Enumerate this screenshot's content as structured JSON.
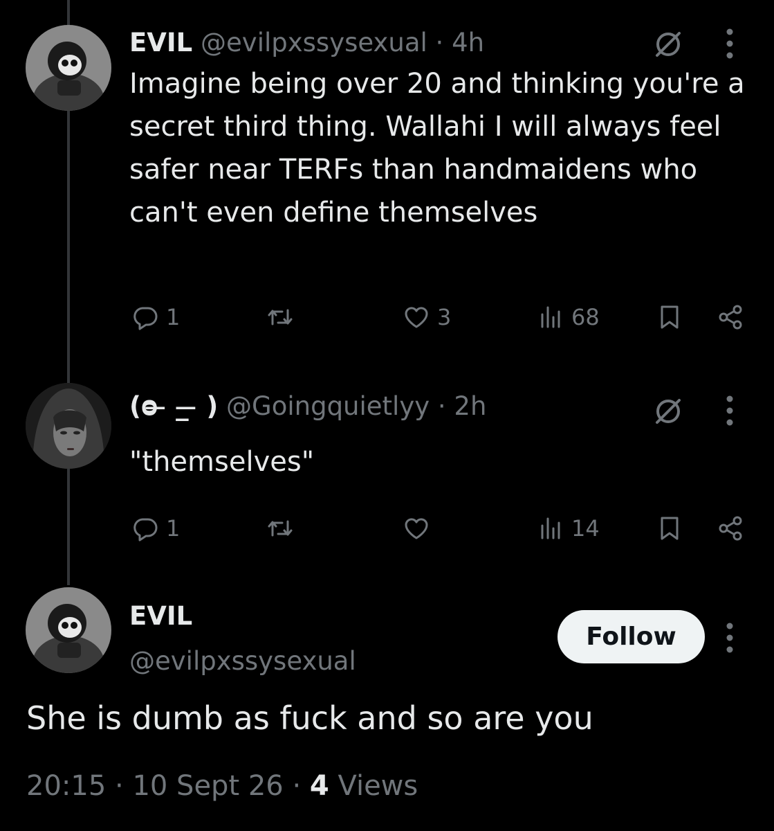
{
  "tweet1": {
    "display_name": "EVIL",
    "handle": "@evilpxssysexual",
    "time": "· 4h",
    "text": "Imagine being over 20 and thinking you're a secret third thing. Wallahi I will always feel safer near TERFs than handmaidens who can't even define themselves",
    "reply_count": "1",
    "like_count": "3",
    "view_count": "68"
  },
  "tweet2": {
    "display_name": "(ᴑ ̶ _ ̶ )",
    "handle": "@Goingquietlyy",
    "time": "· 2h",
    "text": "\"themselves\"",
    "reply_count": "1",
    "like_count": "",
    "view_count": "14"
  },
  "main": {
    "display_name": "EVIL",
    "handle": "@evilpxssysexual",
    "follow_label": "Follow",
    "text": "She is dumb as fuck and so are you",
    "time": "20:15",
    "date": "10 Sept 26",
    "views_count": "4",
    "views_label": "Views"
  },
  "colors": {
    "background": "#000000",
    "text": "#e7e9ea",
    "muted": "#71767b",
    "follow_bg": "#eff3f4"
  },
  "icons": [
    "reply-icon",
    "retweet-icon",
    "like-icon",
    "views-icon",
    "bookmark-icon",
    "share-icon",
    "grok-icon",
    "more-icon"
  ]
}
